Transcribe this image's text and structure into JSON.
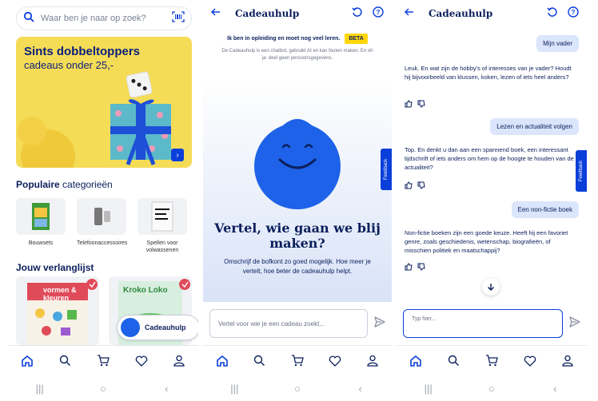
{
  "shop": {
    "search_placeholder": "Waar ben je naar op zoek?",
    "promo_title": "Sints dobbeltoppers",
    "promo_subtitle": "cadeaus onder 25,-",
    "popular_title_bold": "Populaire",
    "popular_title_rest": " categorieën",
    "categories": [
      {
        "label": "Bouwsets"
      },
      {
        "label": "Telefoonaccessoires"
      },
      {
        "label": "Spellen voor volwassenen"
      }
    ],
    "wishlist_title": "Jouw verlanglijst",
    "wishlist_items": [
      {
        "label": "vormen & kleuren"
      },
      {
        "label": "Kroko Loko"
      }
    ],
    "cadeauhulp_pill": "Cadeauhulp"
  },
  "chat_intro": {
    "title": "Cadeauhulp",
    "beta_text": "Ik ben in opleiding en moet nog veel leren.",
    "beta_badge": "BETA",
    "disclaimer": "De Cadeauhulp is een chatbot, gebruikt AI en kan fouten maken. En oh ja: deel geen persoonsgegevens.",
    "hero_title": "Vertel, wie gaan we blij maken?",
    "hero_text": "Omschrijf de bofkont zo goed mogelijk. Hoe meer je vertelt, hoe beter de cadeauhulp helpt.",
    "feedback_label": "Feedback",
    "input_placeholder": "Vertel voor wie je een cadeau zoekt..."
  },
  "chat_convo": {
    "title": "Cadeauhulp",
    "feedback_label": "Feedback",
    "messages": [
      {
        "role": "user",
        "text": "Mijn vader"
      },
      {
        "role": "bot",
        "text": "Leuk. En wat zijn de hobby's of interesses van je vader? Houdt hij bijvoorbeeld van klussen, koken, lezen of iets heel anders?"
      },
      {
        "role": "user",
        "text": "Lezen en actualiteit volgen"
      },
      {
        "role": "bot",
        "text": "Top. En denkt u dan aan een spannend boek, een interessant tijdschrift of iets anders om hem op de hoogte te houden van de actualiteit?"
      },
      {
        "role": "user",
        "text": "Een non-fictie boek"
      },
      {
        "role": "bot",
        "text": "Non-fictie boeken zijn een goede keuze. Heeft hij een favoriet genre, zoals geschiedenis, wetenschap, biografieën, of misschien politiek en maatschappij?"
      }
    ],
    "input_placeholder": "Typ hier..."
  },
  "colors": {
    "brand": "#0b3fd9",
    "navy": "#0b1f5c",
    "promo_bg": "#f5dc57",
    "user_bubble": "#dbe5fb"
  },
  "icons": {
    "nav": [
      "home-icon",
      "search-icon",
      "cart-icon",
      "heart-icon",
      "user-icon"
    ],
    "system": [
      "recents-icon",
      "home-circle-icon",
      "back-chevron-icon"
    ]
  }
}
